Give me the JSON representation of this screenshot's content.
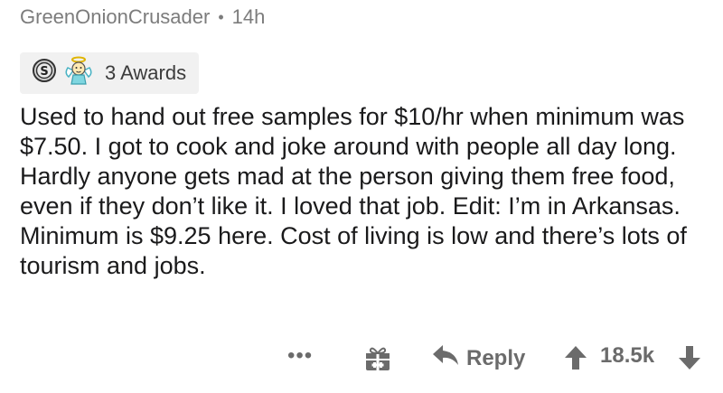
{
  "comment": {
    "author": "GreenOnionCrusader",
    "separator": "•",
    "age": "14h",
    "awards_label": "3 Awards",
    "text": "Used to hand out free samples for $10/hr when minimum was $7.50. I got to cook and joke around with people all day long. Hardly anyone gets mad at the person giving them free food, even if they don’t like it. I loved that job. Edit: I’m in Arkansas. Minimum is $9.25 here. Cost of living is low and there’s lots of tourism and jobs."
  },
  "actions": {
    "more": "•••",
    "reply_label": "Reply",
    "score": "18.5k"
  },
  "icons": {
    "award_1": "silver-award-icon",
    "award_2": "angel-award-icon",
    "gift": "gift-icon",
    "reply": "reply-arrow-icon",
    "upvote": "upvote-arrow-icon",
    "downvote": "downvote-arrow-icon"
  }
}
